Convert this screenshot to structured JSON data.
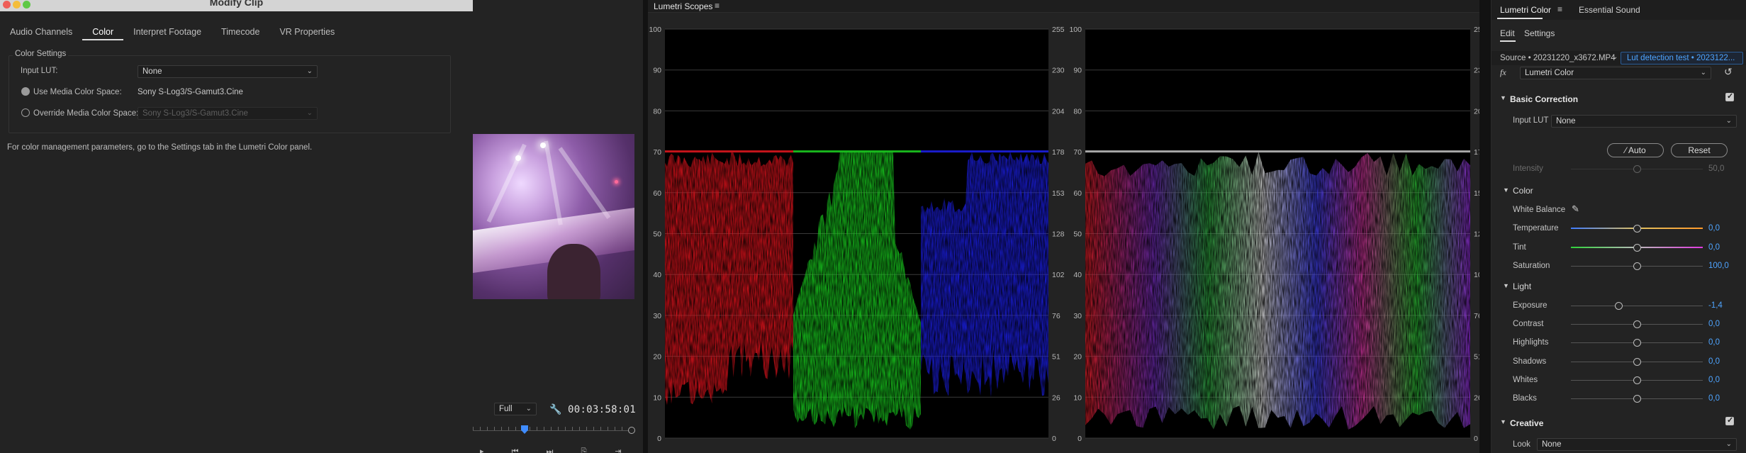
{
  "modify_clip": {
    "title": "Modify Clip",
    "tabs": [
      {
        "label": "Audio Channels"
      },
      {
        "label": "Color"
      },
      {
        "label": "Interpret Footage"
      },
      {
        "label": "Timecode"
      },
      {
        "label": "VR Properties"
      }
    ],
    "active_tab": "Color",
    "group_label": "Color Settings",
    "input_lut_label": "Input LUT:",
    "input_lut_value": "None",
    "use_media_label": "Use Media Color Space:",
    "use_media_value": "Sony S-Log3/S-Gamut3.Cine",
    "override_label": "Override Media Color Space:",
    "override_value": "Sony S-Log3/S-Gamut3.Cine",
    "note": "For color management parameters, go to the Settings tab in the Lumetri Color panel."
  },
  "program_monitor": {
    "fit": "Full",
    "timecode": "00:03:58:01"
  },
  "scopes": {
    "title": "Lumetri Scopes",
    "left_axis": [
      "100",
      "90",
      "80",
      "70",
      "60",
      "50",
      "40",
      "30",
      "20",
      "10",
      "0"
    ],
    "right_axis": [
      "255",
      "230",
      "204",
      "178",
      "153",
      "128",
      "102",
      "76",
      "51",
      "26",
      "0"
    ]
  },
  "lumetri": {
    "tabs": [
      {
        "label": "Lumetri Color"
      },
      {
        "label": "Essential Sound"
      }
    ],
    "subtabs": [
      {
        "label": "Edit"
      },
      {
        "label": "Settings"
      }
    ],
    "source": "Source • 20231220_x3672.MP4",
    "sequence": "Lut detection test • 2023122...",
    "effect": "Lumetri Color",
    "basic_correction": {
      "label": "Basic Correction",
      "input_lut_label": "Input LUT",
      "input_lut_value": "None",
      "auto_label": "Auto",
      "reset_label": "Reset",
      "intensity_label": "Intensity",
      "intensity_value": "50,0",
      "color_label": "Color",
      "white_balance_label": "White Balance",
      "light_label": "Light",
      "color_sliders": [
        {
          "label": "Temperature",
          "value": "0,0",
          "position": 0.5
        },
        {
          "label": "Tint",
          "value": "0,0",
          "position": 0.5
        },
        {
          "label": "Saturation",
          "value": "100,0",
          "position": 0.5
        }
      ],
      "light_sliders": [
        {
          "label": "Exposure",
          "value": "-1,4",
          "position": 0.36
        },
        {
          "label": "Contrast",
          "value": "0,0",
          "position": 0.5
        },
        {
          "label": "Highlights",
          "value": "0,0",
          "position": 0.5
        },
        {
          "label": "Shadows",
          "value": "0,0",
          "position": 0.5
        },
        {
          "label": "Whites",
          "value": "0,0",
          "position": 0.5
        },
        {
          "label": "Blacks",
          "value": "0,0",
          "position": 0.5
        }
      ]
    },
    "creative": {
      "label": "Creative",
      "look_label": "Look",
      "look_value": "None"
    }
  },
  "colors": {
    "accent_blue": "#4ea4ff",
    "panel_bg": "#232323",
    "scope_red": "#d8141c",
    "scope_green": "#19c81e",
    "scope_blue": "#1b1ee0"
  }
}
